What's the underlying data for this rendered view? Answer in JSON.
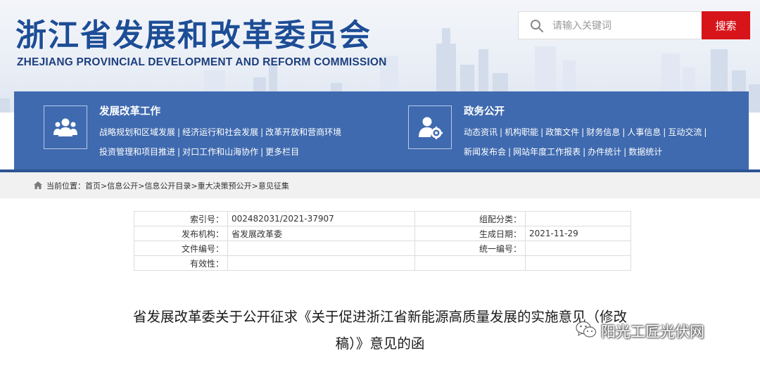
{
  "header": {
    "title": "浙江省发展和改革委员会",
    "subtitle": "ZHEJIANG PROVINCIAL DEVELOPMENT AND REFORM COMMISSION"
  },
  "search": {
    "placeholder": "请输入关键词",
    "value": "",
    "button_label": "搜索",
    "icon": "search-icon"
  },
  "nav": {
    "left": {
      "title": "发展改革工作",
      "icon": "people-group-icon",
      "links": [
        "战略规划和区域发展",
        "经济运行和社会发展",
        "改革开放和营商环境",
        "投资管理和项目推进",
        "对口工作和山海协作",
        "更多栏目"
      ]
    },
    "right": {
      "title": "政务公开",
      "icon": "user-gear-icon",
      "links": [
        "动态资讯",
        "机构职能",
        "政策文件",
        "财务信息",
        "人事信息",
        "互动交流",
        "新闻发布会",
        "网站年度工作报表",
        "办件统计",
        "数据统计"
      ]
    },
    "separator": "|"
  },
  "breadcrumb": {
    "prefix": "当前位置：",
    "items": [
      "首页",
      "信息公开",
      "信息公开目录",
      "重大决策预公开",
      "意见征集"
    ],
    "separator": ">"
  },
  "meta": {
    "index_label": "索引号：",
    "index_value": "002482031/2021-37907",
    "category_label": "组配分类：",
    "category_value": "",
    "publisher_label": "发布机构：",
    "publisher_value": "省发展改革委",
    "date_label": "生成日期：",
    "date_value": "2021-11-29",
    "doc_no_label": "文件编号：",
    "doc_no_value": "",
    "unified_no_label": "统一编号：",
    "unified_no_value": "",
    "validity_label": "有效性：",
    "validity_value": ""
  },
  "document": {
    "title_line1": "省发展改革委关于公开征求《关于促进浙江省新能源高质量发展的实施意见（修改",
    "title_line2": "稿）》意见的函"
  },
  "watermark": {
    "text": "阳光工匠光伏网",
    "icon": "wechat-logo-icon"
  },
  "colors": {
    "title_blue": "#1d4d96",
    "nav_blue": "#3f6aaf",
    "search_red": "#d7141a",
    "breadcrumb_bg": "#f1f1f1"
  }
}
